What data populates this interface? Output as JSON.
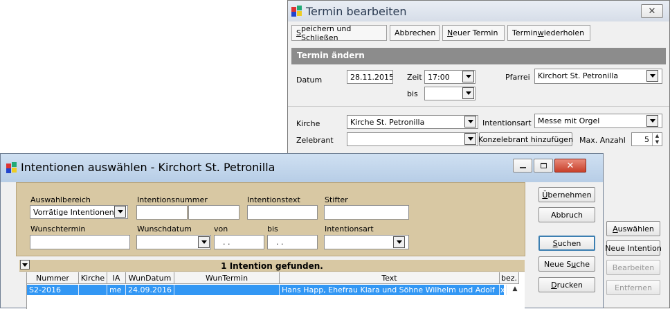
{
  "back_window": {
    "title": "Termin bearbeiten",
    "tabs": [
      "Speichern und Schließen",
      "Abbrechen",
      "Neuer Termin",
      "Termin wiederholen"
    ],
    "section_title": "Termin ändern",
    "datum_label": "Datum",
    "datum_value": "28.11.2015",
    "zeit_label": "Zeit",
    "zeit_value": "17:00",
    "bis_label": "bis",
    "pfarrei_label": "Pfarrei",
    "pfarrei_value": "Kirchort St. Petronilla",
    "kirche_label": "Kirche",
    "kirche_value": "Kirche St. Petronilla",
    "intentionsart_label": "Intentionsart",
    "intentionsart_value": "Messe mit Orgel",
    "zelebrant_label": "Zelebrant",
    "konzelebrant_button": "Konzelebrant hinzufügen",
    "max_anzahl_label": "Max. Anzahl",
    "max_anzahl_value": "5",
    "side_buttons": [
      "Auswählen",
      "Neue Intention",
      "Bearbeiten",
      "Entfernen"
    ]
  },
  "front_window": {
    "title": "Intentionen auswählen - Kirchort St. Petronilla",
    "auswahlbereich_label": "Auswahlbereich",
    "auswahlbereich_value": "Vorrätige Intentionen",
    "intentionsnummer_label": "Intentionsnummer",
    "intentionstext_label": "Intentionstext",
    "stifter_label": "Stifter",
    "wunschtermin_label": "Wunschtermin",
    "wunschdatum_label": "Wunschdatum",
    "von_label": "von",
    "bis_label": "bis",
    "von_value": ". .",
    "bis_value": ". .",
    "intentionsart_label": "Intentionsart",
    "result_text": "1 Intention gefunden.",
    "buttons": [
      "Übernehmen",
      "Abbruch",
      "Suchen",
      "Neue Suche",
      "Drucken"
    ],
    "columns": [
      "Nummer",
      "Kirche",
      "IA",
      "WunDatum",
      "WunTermin",
      "Text",
      "bez."
    ],
    "rows": [
      [
        "S2-2016",
        "",
        "me",
        "24.09.2016",
        "",
        "Hans Happ, Ehefrau Klara und Söhne Wilhelm und Adolf",
        "x"
      ]
    ]
  }
}
